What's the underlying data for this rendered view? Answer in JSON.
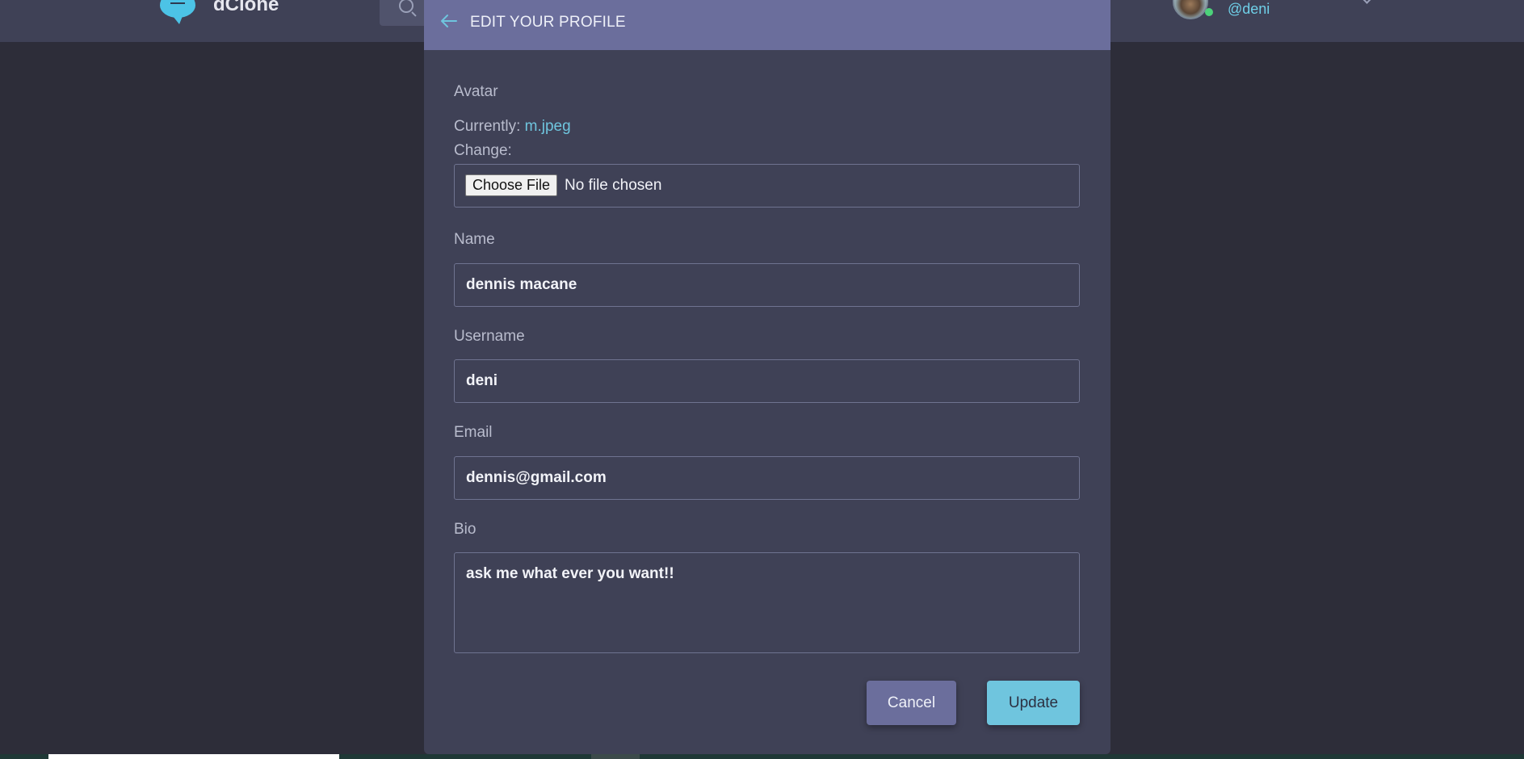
{
  "app": {
    "name": "dClone"
  },
  "header": {
    "username": "@deni"
  },
  "modal": {
    "title": "EDIT YOUR PROFILE",
    "avatar": {
      "label": "Avatar",
      "currently_label": "Currently:",
      "current_file": "m.jpeg",
      "change_label": "Change:",
      "choose_button": "Choose File",
      "file_status": "No file chosen"
    },
    "name": {
      "label": "Name",
      "value": "dennis macane"
    },
    "username": {
      "label": "Username",
      "value": "deni"
    },
    "email": {
      "label": "Email",
      "value": "dennis@gmail.com"
    },
    "bio": {
      "label": "Bio",
      "value": "ask me what ever you want!!"
    },
    "buttons": {
      "cancel": "Cancel",
      "update": "Update"
    }
  },
  "colors": {
    "page_background": "#2d2d39",
    "panel": "#3f4156",
    "modal_header": "#6b6e9c",
    "accent": "#6fc5de",
    "online": "#4cd27a"
  },
  "icons": {
    "logo": "chat-bubble-menu-icon",
    "search": "search-icon",
    "back": "arrow-left-icon",
    "dropdown": "chevron-down-icon"
  }
}
